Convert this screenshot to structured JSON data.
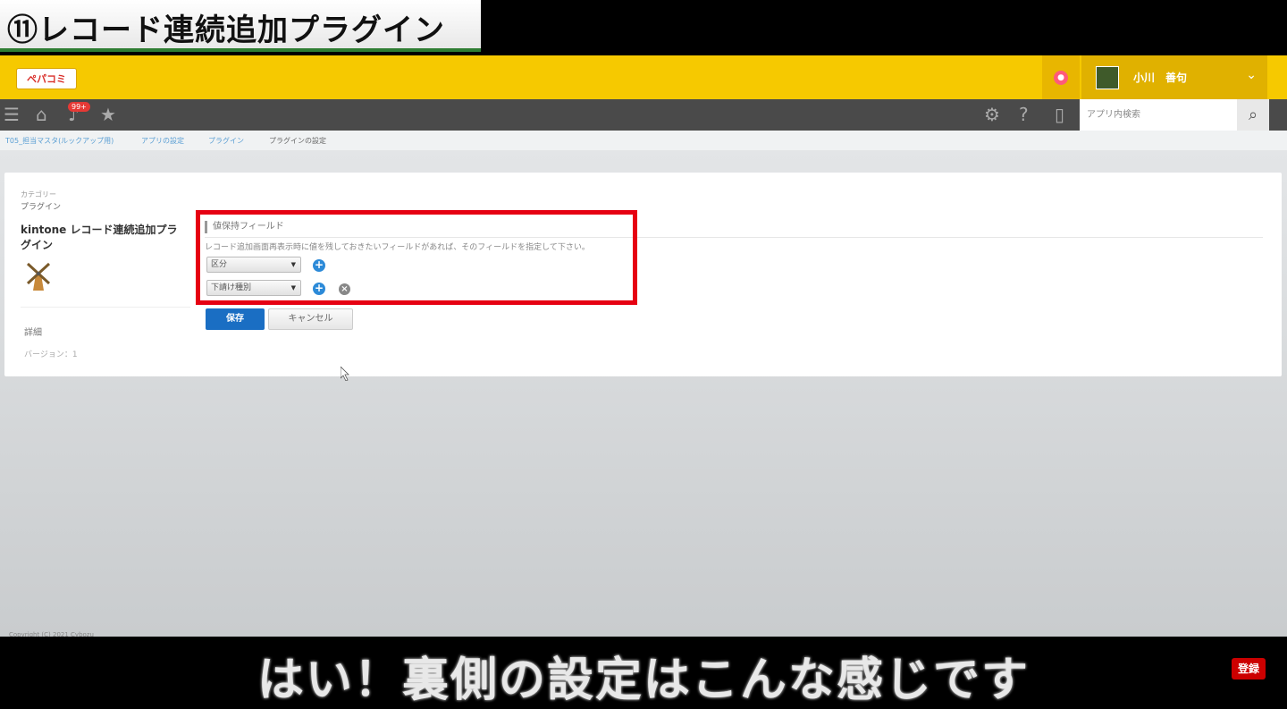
{
  "banner": {
    "title": "⑪レコード連続追加プラグイン"
  },
  "header": {
    "logo_text": "ペパコミ",
    "user_name": "小川　善句"
  },
  "toolbar": {
    "notification_badge": "99+",
    "search_placeholder": "アプリ内検索"
  },
  "breadcrumb": {
    "items": [
      "T05_担当マスタ(ルックアップ用)",
      "アプリの設定",
      "プラグイン",
      "プラグインの設定"
    ]
  },
  "sidebar": {
    "category_label": "カテゴリー",
    "category_value": "プラグイン",
    "plugin_name": "kintone レコード連続追加プラグイン",
    "detail_label": "詳細",
    "version_text": "バージョン：1"
  },
  "settings": {
    "field_title": "値保持フィールド",
    "description": "レコード追加画面再表示時に値を残しておきたいフィールドがあれば、そのフィールドを指定して下さい。",
    "rows": [
      {
        "selected": "区分"
      },
      {
        "selected": "下請け種別"
      }
    ],
    "save_label": "保存",
    "cancel_label": "キャンセル"
  },
  "footer": {
    "copyright": "Copyright (C) 2021 Cybozu"
  },
  "subtitle": {
    "text": "はい！裏側の設定はこんな感じです",
    "logo_text": "登録"
  },
  "colors": {
    "header_yellow": "#f6c900",
    "highlight_red": "#e60012",
    "primary_blue": "#1a6ec3"
  }
}
